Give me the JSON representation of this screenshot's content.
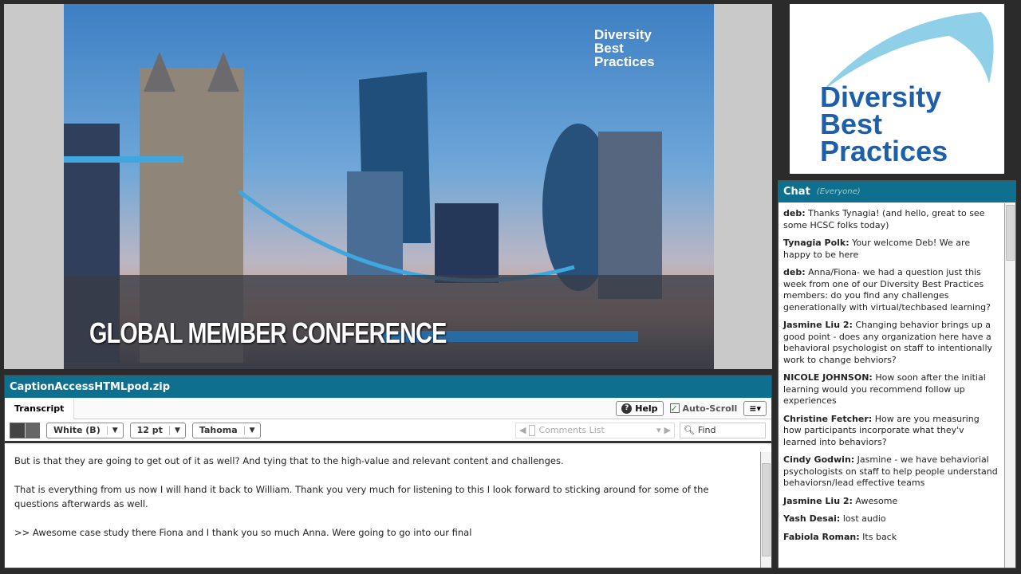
{
  "slide": {
    "logo": "Diversity Best Practices",
    "title": "GLOBAL MEMBER CONFERENCE"
  },
  "logo_pod": {
    "logo": "Diversity Best Practices"
  },
  "chat": {
    "title": "Chat",
    "scope": "(Everyone)",
    "messages": [
      {
        "sender": "deb:",
        "text": "Thanks Tynagia! (and hello, great to see some HCSC folks today)"
      },
      {
        "sender": "Tynagia Polk:",
        "text": "Your welcome Deb!  We are happy to be here"
      },
      {
        "sender": "deb:",
        "text": "Anna/Fiona- we had a question just this week from one of our Diversity Best Practices members: do you find any challenges generationally with virtual/techbased learning?"
      },
      {
        "sender": "Jasmine Liu 2:",
        "text": "Changing behavior brings up a good point - does any organization here have a behavioral psychologist on staff to intentionally work to change behviors?"
      },
      {
        "sender": "NICOLE JOHNSON:",
        "text": "How soon after the initial learning would you recommend follow up experiences"
      },
      {
        "sender": "Christine Fetcher:",
        "text": "How are you measuring how participants incorporate what they'v learned into behaviors?"
      },
      {
        "sender": "Cindy Godwin:",
        "text": "Jasmine - we have behaviorial psychologists on staff to help people understand behaviorsn/lead effective teams"
      },
      {
        "sender": "Jasmine Liu 2:",
        "text": "Awesome"
      },
      {
        "sender": "Yash Desai:",
        "text": "lost audio"
      },
      {
        "sender": "Fabiola Roman:",
        "text": "Its back"
      }
    ]
  },
  "caption": {
    "title": "CaptionAccessHTMLpod.zip",
    "tab": "Transcript",
    "help": "Help",
    "autoscroll": "Auto-Scroll",
    "color": "White (B)",
    "size": "12 pt",
    "font": "Tahoma",
    "comments": "Comments List",
    "find": "Find",
    "lines": [
      "But is that they are going to get out of it as well? And tying that to the high-value and relevant content and challenges.",
      "That is everything from us now I will hand it back to William. Thank you very much for listening to this I look forward to sticking around for some of the questions afterwards as well.",
      ">> Awesome case study there Fiona and I thank you so much Anna. Were going to go into our final"
    ]
  }
}
